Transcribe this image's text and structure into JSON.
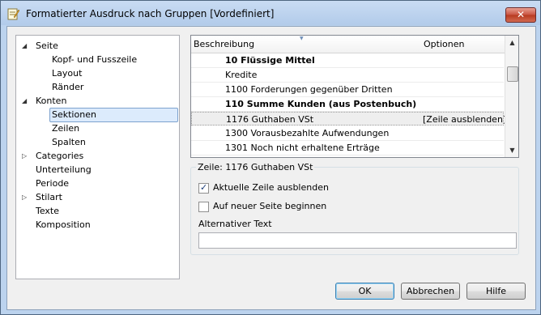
{
  "window": {
    "title": "Formatierter Ausdruck nach Gruppen [Vordefiniert]",
    "close_glyph": "✕"
  },
  "tree": {
    "items": [
      {
        "label": "Seite",
        "arrow": "◢"
      },
      {
        "label": "Kopf- und Fusszeile",
        "arrow": ""
      },
      {
        "label": "Layout",
        "arrow": ""
      },
      {
        "label": "Ränder",
        "arrow": ""
      },
      {
        "label": "Konten",
        "arrow": "◢"
      },
      {
        "label": "Sektionen",
        "arrow": ""
      },
      {
        "label": "Zeilen",
        "arrow": ""
      },
      {
        "label": "Spalten",
        "arrow": ""
      },
      {
        "label": "Categories",
        "arrow": "▷"
      },
      {
        "label": "Unterteilung",
        "arrow": ""
      },
      {
        "label": "Periode",
        "arrow": ""
      },
      {
        "label": "Stilart",
        "arrow": "▷"
      },
      {
        "label": "Texte",
        "arrow": ""
      },
      {
        "label": "Komposition",
        "arrow": ""
      }
    ],
    "selected": "Sektionen"
  },
  "grid": {
    "columns": {
      "description": "Beschreibung",
      "options": "Optionen"
    },
    "rows": [
      {
        "description": "10 Flüssige Mittel",
        "options": "",
        "bold": true
      },
      {
        "description": "Kredite",
        "options": "",
        "bold": false
      },
      {
        "description": "1100 Forderungen gegenüber Dritten",
        "options": "",
        "bold": false
      },
      {
        "description": "110 Summe Kunden (aus Postenbuch)",
        "options": "",
        "bold": true
      },
      {
        "description": "1176 Guthaben VSt",
        "options": "[Zeile  ausblenden]",
        "bold": false
      },
      {
        "description": "1300 Vorausbezahlte Aufwendungen",
        "options": "",
        "bold": false
      },
      {
        "description": "1301 Noch nicht erhaltene Erträge",
        "options": "",
        "bold": false
      }
    ],
    "selected_row": "1176 Guthaben VSt"
  },
  "row_settings": {
    "group_title": "Zeile: 1176 Guthaben VSt",
    "hide_row_label": "Aktuelle Zeile ausblenden",
    "hide_row_checked": true,
    "new_page_label": "Auf neuer Seite beginnen",
    "new_page_checked": false,
    "alt_text_label": "Alternativer Text",
    "alt_text_value": ""
  },
  "buttons": {
    "ok": "OK",
    "cancel": "Abbrechen",
    "help": "Hilfe"
  },
  "colors": {
    "selection_bg": "#dcebfc",
    "title_bar": "#c9dcf3",
    "close_button": "#c8523f"
  }
}
